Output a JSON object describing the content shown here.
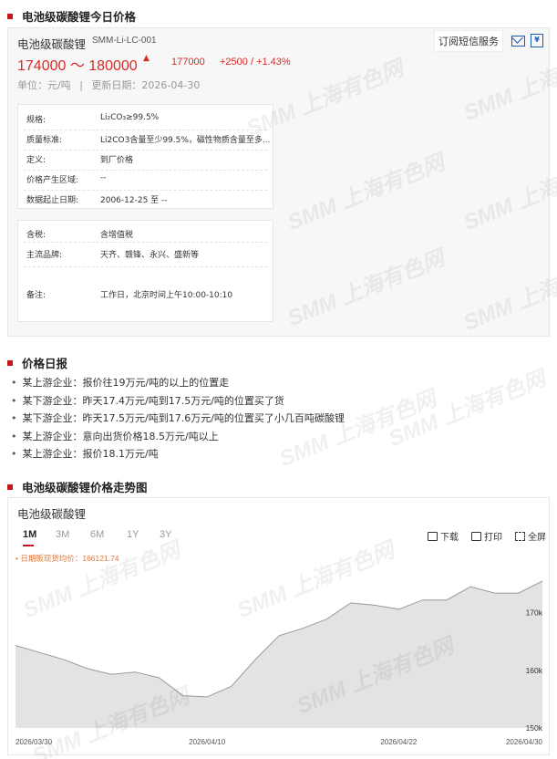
{
  "section1": {
    "title": "电池级碳酸锂今日价格"
  },
  "product": {
    "name": "电池级碳酸锂",
    "code": "SMM-Li-LC-001",
    "subscribe_label": "订阅短信服务",
    "price_range": "174000 ～ 180000",
    "average": "177000",
    "change": "+2500 / +1.43%",
    "unit": "单位：元/吨",
    "update": "更新日期：2026-04-30",
    "separator": "|"
  },
  "info1": [
    {
      "k": "规格:",
      "v": "Li₂CO₃≥99.5%"
    },
    {
      "k": "质量标准:",
      "v": "Li2CO3含量至少99.5%，磁性物质含量至多..."
    },
    {
      "k": "定义:",
      "v": "到厂价格"
    },
    {
      "k": "价格产生区域:",
      "v": "--"
    },
    {
      "k": "数据起止日期:",
      "v": "2006-12-25 至 --"
    }
  ],
  "info2": [
    {
      "k": "含税:",
      "v": "含增值税"
    },
    {
      "k": "主流品牌:",
      "v": "天齐、赣锋、永兴、盛新等"
    },
    {
      "k": "备注:",
      "v": "工作日，北京时间上午10:00-10:10"
    }
  ],
  "section2": {
    "title": "价格日报"
  },
  "report": [
    "某上游企业：报价往19万元/吨的以上的位置走",
    "某下游企业：昨天17.4万元/吨到17.5万元/吨的位置买了货",
    "某下游企业：昨天17.5万元/吨到17.6万元/吨的位置买了小几百吨碳酸锂",
    "某上游企业：意向出货价格18.5万元/吨以上",
    "某上游企业：报价18.1万元/吨"
  ],
  "section3": {
    "title": "电池级碳酸锂价格走势图"
  },
  "chart_panel": {
    "name": "电池级碳酸锂",
    "tabs": [
      "1M",
      "3M",
      "6M",
      "1Y",
      "3Y"
    ],
    "active_tab": "1M",
    "download": "下载",
    "print": "打印",
    "fullscreen": "全屏",
    "legend": "• 日期販现货均价：166121.74"
  },
  "chart_data": {
    "type": "area",
    "x": [
      "2026-03-30",
      "2026-03-31",
      "2026-04-01",
      "2026-04-02",
      "2026-04-03",
      "2026-04-07",
      "2026-04-08",
      "2026-04-09",
      "2026-04-10",
      "2026-04-13",
      "2026-04-14",
      "2026-04-15",
      "2026-04-16",
      "2026-04-17",
      "2026-04-20",
      "2026-04-21",
      "2026-04-22",
      "2026-04-23",
      "2026-04-24",
      "2026-04-27",
      "2026-04-28",
      "2026-04-29",
      "2026-04-30"
    ],
    "values": [
      164300,
      163100,
      161900,
      160300,
      159300,
      159700,
      158700,
      155600,
      155400,
      157200,
      161800,
      166000,
      167300,
      168900,
      171700,
      171300,
      170600,
      172200,
      172200,
      174500,
      173400,
      173400,
      175500
    ],
    "x_tick_labels": [
      "2026/03/30",
      "2026/04/10",
      "2026/04/22",
      "2026/04/30"
    ],
    "y_tick_labels": [
      "150k",
      "160k",
      "170k"
    ],
    "ylim": [
      150000,
      178800
    ],
    "grid": false,
    "colors": {
      "fill": "#e3e3e3",
      "line": "#9a9a9a"
    }
  },
  "watermark": "SMM 上海有色网",
  "colors": {
    "accent": "#c8161d",
    "price": "#d62b26",
    "icon": "#1a5bb8"
  }
}
